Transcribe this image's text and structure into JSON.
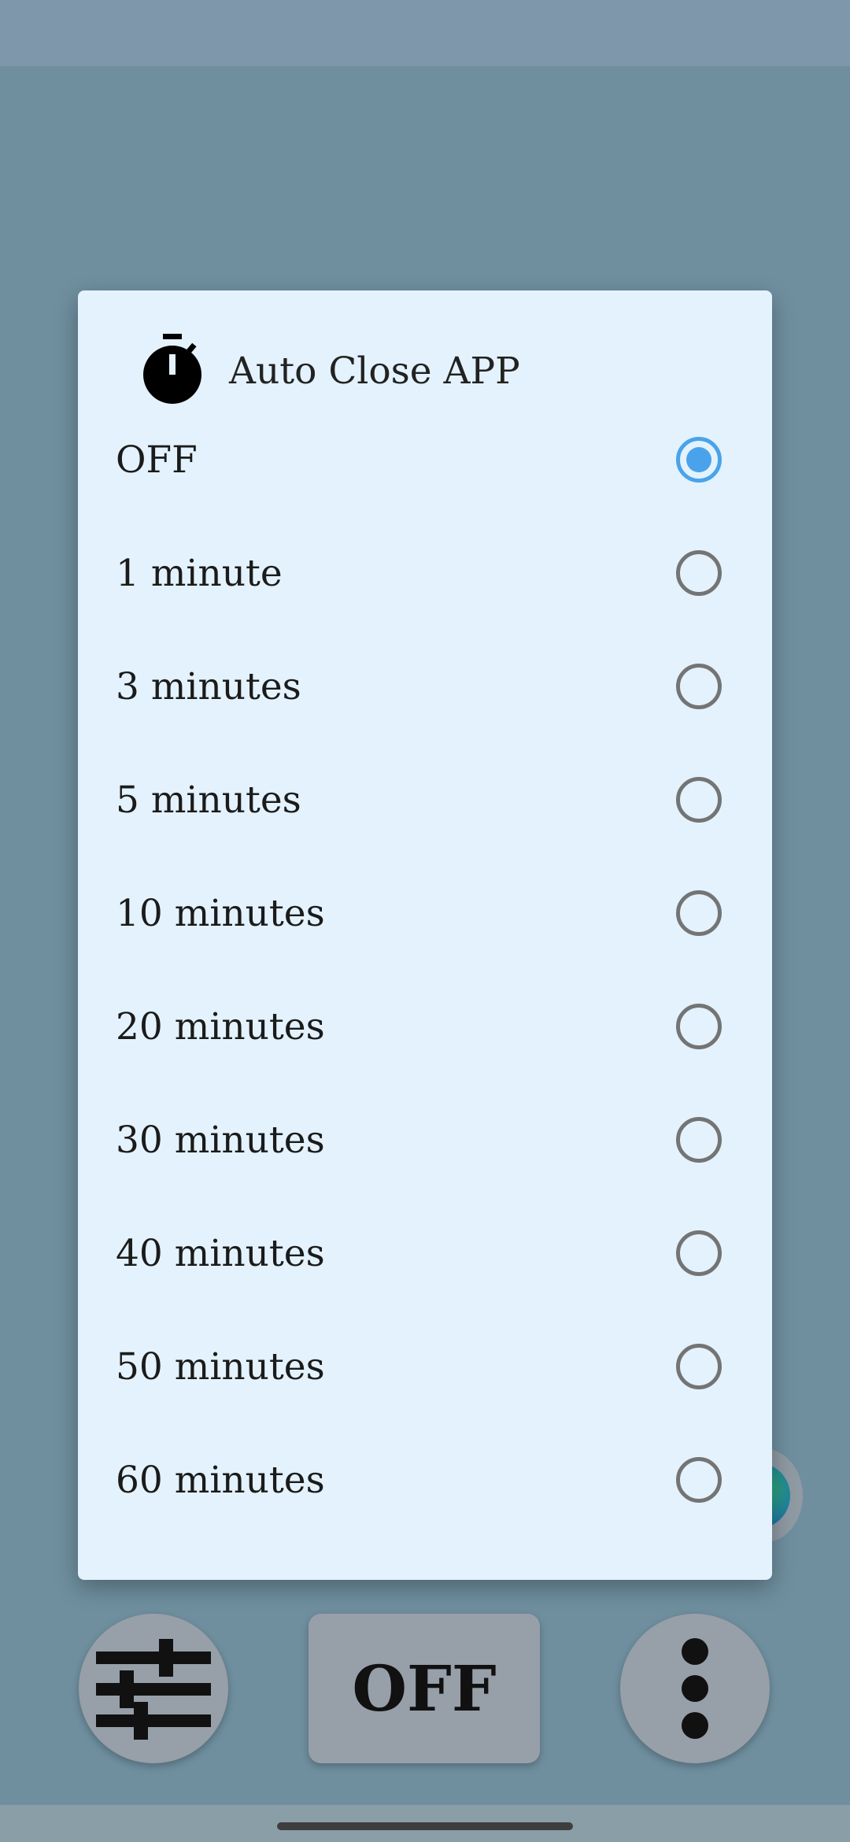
{
  "dialog": {
    "title": "Auto Close APP",
    "icon": "stopwatch-icon",
    "selected_index": 0,
    "options": [
      {
        "label": "OFF",
        "checked": true
      },
      {
        "label": "1 minute",
        "checked": false
      },
      {
        "label": "3 minutes",
        "checked": false
      },
      {
        "label": "5 minutes",
        "checked": false
      },
      {
        "label": "10 minutes",
        "checked": false
      },
      {
        "label": "20 minutes",
        "checked": false
      },
      {
        "label": "30 minutes",
        "checked": false
      },
      {
        "label": "40 minutes",
        "checked": false
      },
      {
        "label": "50 minutes",
        "checked": false
      },
      {
        "label": "60 minutes",
        "checked": false
      }
    ]
  },
  "bottom_bar": {
    "settings_icon": "sliders-icon",
    "off_label": "OFF",
    "more_icon": "more-vertical-icon"
  },
  "colors": {
    "accent": "#4aa3ea",
    "dialog_background": "#e3f2fc",
    "scrim": "#6f8f9f"
  }
}
